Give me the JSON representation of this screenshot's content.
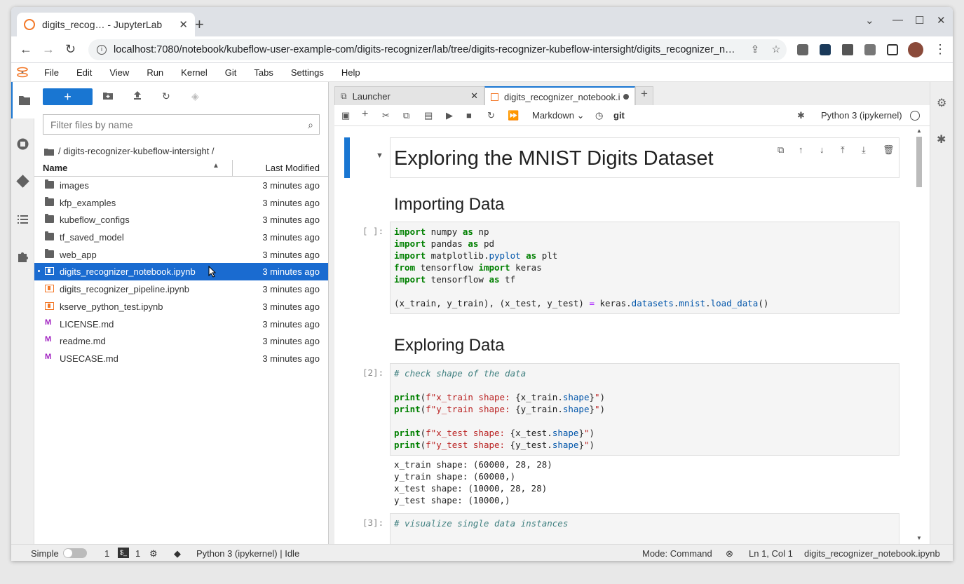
{
  "browser": {
    "tab_title": "digits_recog… - JupyterLab",
    "url": "localhost:7080/notebook/kubeflow-user-example-com/digits-recognizer/lab/tree/digits-recognizer-kubeflow-intersight/digits_recognizer_n…"
  },
  "menu": [
    "File",
    "Edit",
    "View",
    "Run",
    "Kernel",
    "Git",
    "Tabs",
    "Settings",
    "Help"
  ],
  "filebrowser": {
    "new_label": "+",
    "filter_placeholder": "Filter files by name",
    "breadcrumb": "/ digits-recognizer-kubeflow-intersight /",
    "col_name": "Name",
    "col_modified": "Last Modified",
    "files": [
      {
        "name": "images",
        "type": "folder",
        "modified": "3 minutes ago"
      },
      {
        "name": "kfp_examples",
        "type": "folder",
        "modified": "3 minutes ago"
      },
      {
        "name": "kubeflow_configs",
        "type": "folder",
        "modified": "3 minutes ago"
      },
      {
        "name": "tf_saved_model",
        "type": "folder",
        "modified": "3 minutes ago"
      },
      {
        "name": "web_app",
        "type": "folder",
        "modified": "3 minutes ago"
      },
      {
        "name": "digits_recognizer_notebook.ipynb",
        "type": "notebook",
        "modified": "3 minutes ago",
        "selected": true
      },
      {
        "name": "digits_recognizer_pipeline.ipynb",
        "type": "notebook",
        "modified": "3 minutes ago"
      },
      {
        "name": "kserve_python_test.ipynb",
        "type": "notebook",
        "modified": "3 minutes ago"
      },
      {
        "name": "LICENSE.md",
        "type": "markdown",
        "modified": "3 minutes ago"
      },
      {
        "name": "readme.md",
        "type": "markdown",
        "modified": "3 minutes ago"
      },
      {
        "name": "USECASE.md",
        "type": "markdown",
        "modified": "3 minutes ago"
      }
    ]
  },
  "notebook": {
    "tabs": [
      {
        "label": "Launcher"
      },
      {
        "label": "digits_recognizer_notebook.ipynb"
      }
    ],
    "cell_type": "Markdown",
    "git_label": "git",
    "kernel": "Python 3 (ipykernel)",
    "title": "Exploring the MNIST Digits Dataset",
    "h_import": "Importing Data",
    "h_explore": "Exploring Data",
    "prompt1": "[ ]:",
    "prompt2": "[2]:",
    "prompt3": "[3]:",
    "output2": "x_train shape: (60000, 28, 28)\ny_train shape: (60000,)\nx_test shape: (10000, 28, 28)\ny_test shape: (10000,)",
    "code3_comment": "# visualize single data instances"
  },
  "status": {
    "simple": "Simple",
    "terminals": "1",
    "kernels": "1",
    "kernel_status": "Python 3 (ipykernel) | Idle",
    "mode": "Mode: Command",
    "position": "Ln 1, Col 1",
    "file": "digits_recognizer_notebook.ipynb"
  }
}
